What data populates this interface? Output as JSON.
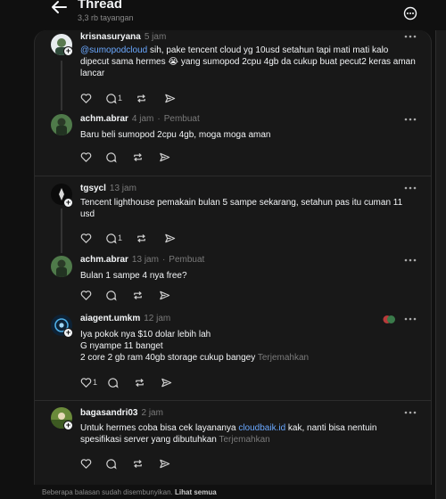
{
  "header": {
    "title": "Thread",
    "views": "3,3 rb tayangan"
  },
  "posts": [
    {
      "username": "krisnasuryana",
      "time": "5 jam",
      "author_tag": "",
      "mention": "@sumopodcloud",
      "text": " sih, pake tencent cloud yg 10usd setahun tapi mati mati kalo dipecut sama hermes 😭 yang sumopod 2cpu 4gb da cukup buat pecut2 keras aman lancar",
      "reply_count": "1"
    },
    {
      "username": "achm.abrar",
      "time": "4 jam",
      "author_tag": "Pembuat",
      "text": "Baru beli sumopod 2cpu 4gb, moga moga aman",
      "reply_count": ""
    },
    {
      "username": "tgsycl",
      "time": "13 jam",
      "author_tag": "",
      "text": "Tencent lighthouse pemakain bulan 5 sampe sekarang, setahun pas itu cuman 11 usd",
      "reply_count": "1"
    },
    {
      "username": "achm.abrar",
      "time": "13 jam",
      "author_tag": "Pembuat",
      "text": "Bulan 1 sampe 4 nya free?",
      "reply_count": ""
    },
    {
      "username": "aiagent.umkm",
      "time": "12 jam",
      "author_tag": "",
      "lines": [
        "Iya pokok nya $10 dolar lebih lah",
        "G nyampe 11 banget",
        "2 core 2 gb ram 40gb storage cukup bangey"
      ],
      "translate": "Terjemahkan",
      "like_count": "1"
    },
    {
      "username": "bagasandri03",
      "time": "2 jam",
      "author_tag": "",
      "text_before": "Untuk hermes coba bisa cek layananya ",
      "link": "cloudbaik.id",
      "text_after": " kak, nanti bisa nentuin spesifikasi server yang dibutuhkan",
      "translate": "Terjemahkan"
    }
  ],
  "footer": {
    "note": "Beberapa balasan sudah disembunyikan.",
    "link": "Lihat semua"
  },
  "icons": [
    "back-arrow-icon",
    "more-circle-icon",
    "more-dots-icon",
    "heart-icon",
    "comment-icon",
    "repost-icon",
    "share-icon"
  ]
}
